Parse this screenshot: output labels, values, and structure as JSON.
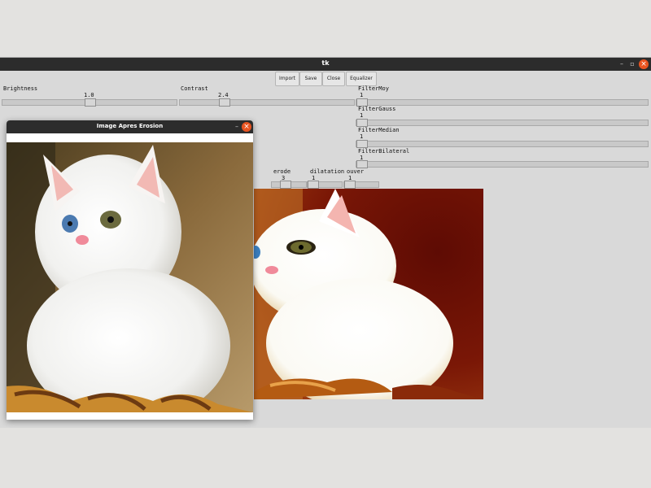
{
  "main_window": {
    "title": "tk",
    "buttons": {
      "import": "Import",
      "save": "Save",
      "close": "Close",
      "equalizer": "Equalizer"
    },
    "sliders": {
      "brightness": {
        "label": "Brightness",
        "value": "1.0"
      },
      "contrast": {
        "label": "Contrast",
        "value": "2.4"
      },
      "filter_moy": {
        "label": "FilterMoy",
        "value": "1"
      },
      "filter_gauss": {
        "label": "FilterGauss",
        "value": "1"
      },
      "filter_median": {
        "label": "FilterMedian",
        "value": "1"
      },
      "filter_bilateral": {
        "label": "FilterBilateral",
        "value": "1"
      },
      "erode": {
        "label": "erode",
        "value": "3"
      },
      "dilatation": {
        "label": "dilatation",
        "value": "1"
      },
      "ouver": {
        "label": "ouver",
        "value": "1"
      }
    }
  },
  "erosion_window": {
    "title": "Image Apres Erosion"
  },
  "icons": {
    "minimize": "minimize-icon",
    "maximize": "maximize-icon",
    "close": "close-icon"
  },
  "colors": {
    "titlebar": "#2c2c2c",
    "close_accent": "#e95420",
    "window_bg": "#d9d9d9"
  }
}
